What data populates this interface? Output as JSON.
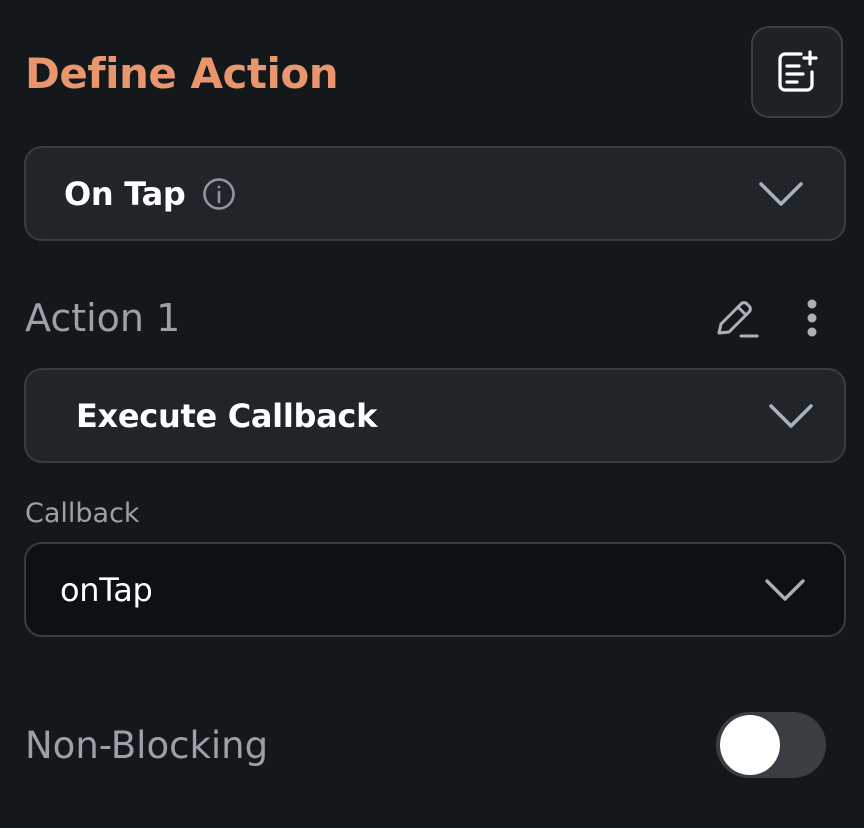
{
  "header": {
    "title": "Define Action",
    "add_button_icon": "add-note-icon"
  },
  "trigger": {
    "selected": "On Tap",
    "info_icon": "info-icon",
    "chevron_icon": "chevron-down-icon"
  },
  "action": {
    "title": "Action 1",
    "edit_icon": "pencil-icon",
    "more_icon": "more-vertical-icon",
    "type_selected": "Execute Callback"
  },
  "callback": {
    "label": "Callback",
    "selected": "onTap"
  },
  "non_blocking": {
    "label": "Non-Blocking",
    "enabled": false
  },
  "colors": {
    "accent": "#e9956e",
    "background": "#14181b",
    "panel": "#20252a",
    "muted_text": "#9aa1a8"
  }
}
